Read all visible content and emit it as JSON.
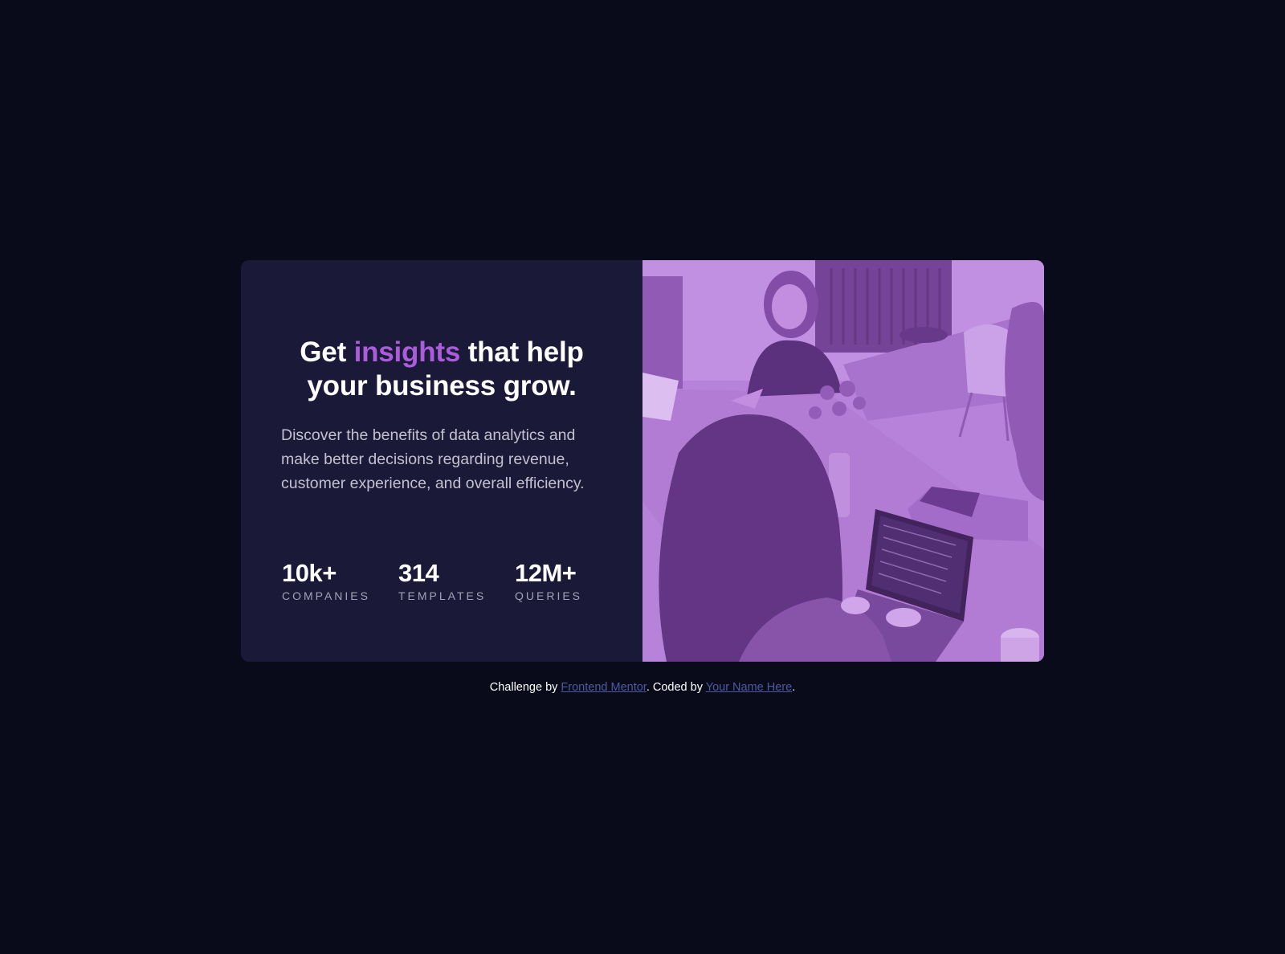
{
  "hero": {
    "headline_before": "Get ",
    "headline_accent": "insights",
    "headline_after": " that help your business grow.",
    "description": "Discover the benefits of data analytics and make better decisions regarding revenue, customer experience, and overall efficiency."
  },
  "stats": [
    {
      "value": "10k+",
      "label": "COMPANIES"
    },
    {
      "value": "314",
      "label": "TEMPLATES"
    },
    {
      "value": "12M+",
      "label": "QUERIES"
    }
  ],
  "image": {
    "alt": "people working at a table with laptops",
    "tint": "#aa5cdb"
  },
  "attribution": {
    "prefix": "Challenge by ",
    "link1": "Frontend Mentor",
    "middle": ". Coded by ",
    "link2": "Your Name Here",
    "suffix": "."
  },
  "colors": {
    "background": "#090b1b",
    "card": "#1b1938",
    "accent": "#aa5cdb",
    "link": "#4c5ba0"
  }
}
